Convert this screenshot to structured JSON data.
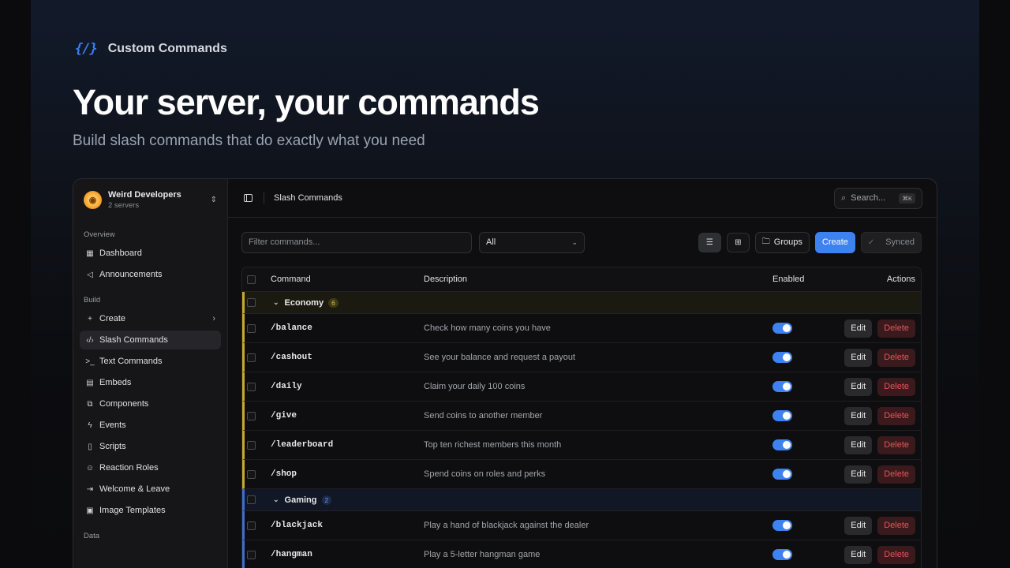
{
  "brand": {
    "icon": "{/}",
    "name": "Custom Commands"
  },
  "hero": {
    "title": "Your server, your commands",
    "subtitle": "Build slash commands that do exactly what you need"
  },
  "workspace": {
    "name": "Weird Developers",
    "sub": "2 servers"
  },
  "sidebar": {
    "sections": [
      {
        "label": "Overview",
        "items": [
          {
            "icon": "grid-icon",
            "glyph": "▦",
            "label": "Dashboard"
          },
          {
            "icon": "megaphone-icon",
            "glyph": "◁",
            "label": "Announcements"
          }
        ]
      },
      {
        "label": "Build",
        "items": [
          {
            "icon": "plus-icon",
            "glyph": "+",
            "label": "Create",
            "chevron": "›"
          },
          {
            "icon": "code-icon",
            "glyph": "‹/›",
            "label": "Slash Commands",
            "active": true
          },
          {
            "icon": "terminal-icon",
            "glyph": ">_",
            "label": "Text Commands"
          },
          {
            "icon": "embed-icon",
            "glyph": "▤",
            "label": "Embeds"
          },
          {
            "icon": "components-icon",
            "glyph": "⧉",
            "label": "Components"
          },
          {
            "icon": "bolt-icon",
            "glyph": "ϟ",
            "label": "Events"
          },
          {
            "icon": "file-icon",
            "glyph": "▯",
            "label": "Scripts"
          },
          {
            "icon": "reaction-icon",
            "glyph": "☺",
            "label": "Reaction Roles"
          },
          {
            "icon": "door-icon",
            "glyph": "⇥",
            "label": "Welcome & Leave"
          },
          {
            "icon": "image-icon",
            "glyph": "▣",
            "label": "Image Templates"
          }
        ]
      },
      {
        "label": "Data",
        "items": []
      }
    ]
  },
  "topbar": {
    "breadcrumb": "Slash Commands",
    "search_label": "Search...",
    "search_kbd": "⌘K"
  },
  "toolbar": {
    "filter_placeholder": "Filter commands...",
    "select_value": "All",
    "groups_label": "Groups",
    "create_label": "Create",
    "synced_label": "Synced"
  },
  "table": {
    "headers": {
      "command": "Command",
      "description": "Description",
      "enabled": "Enabled",
      "actions": "Actions"
    },
    "edit_label": "Edit",
    "delete_label": "Delete",
    "groups": [
      {
        "name": "Economy",
        "count": "6",
        "style": "economy",
        "accent": "#c8a92b",
        "rows": [
          {
            "command": "/balance",
            "description": "Check how many coins you have",
            "enabled": true
          },
          {
            "command": "/cashout",
            "description": "See your balance and request a payout",
            "enabled": true
          },
          {
            "command": "/daily",
            "description": "Claim your daily 100 coins",
            "enabled": true
          },
          {
            "command": "/give",
            "description": "Send coins to another member",
            "enabled": true
          },
          {
            "command": "/leaderboard",
            "description": "Top ten richest members this month",
            "enabled": true
          },
          {
            "command": "/shop",
            "description": "Spend coins on roles and perks",
            "enabled": true
          }
        ]
      },
      {
        "name": "Gaming",
        "count": "2",
        "style": "gaming",
        "accent": "#3e6fc9",
        "rows": [
          {
            "command": "/blackjack",
            "description": "Play a hand of blackjack against the dealer",
            "enabled": true
          },
          {
            "command": "/hangman",
            "description": "Play a 5-letter hangman game",
            "enabled": true
          }
        ]
      }
    ]
  },
  "colors": {
    "accent": "#3e82f0",
    "danger": "#e0575b"
  }
}
